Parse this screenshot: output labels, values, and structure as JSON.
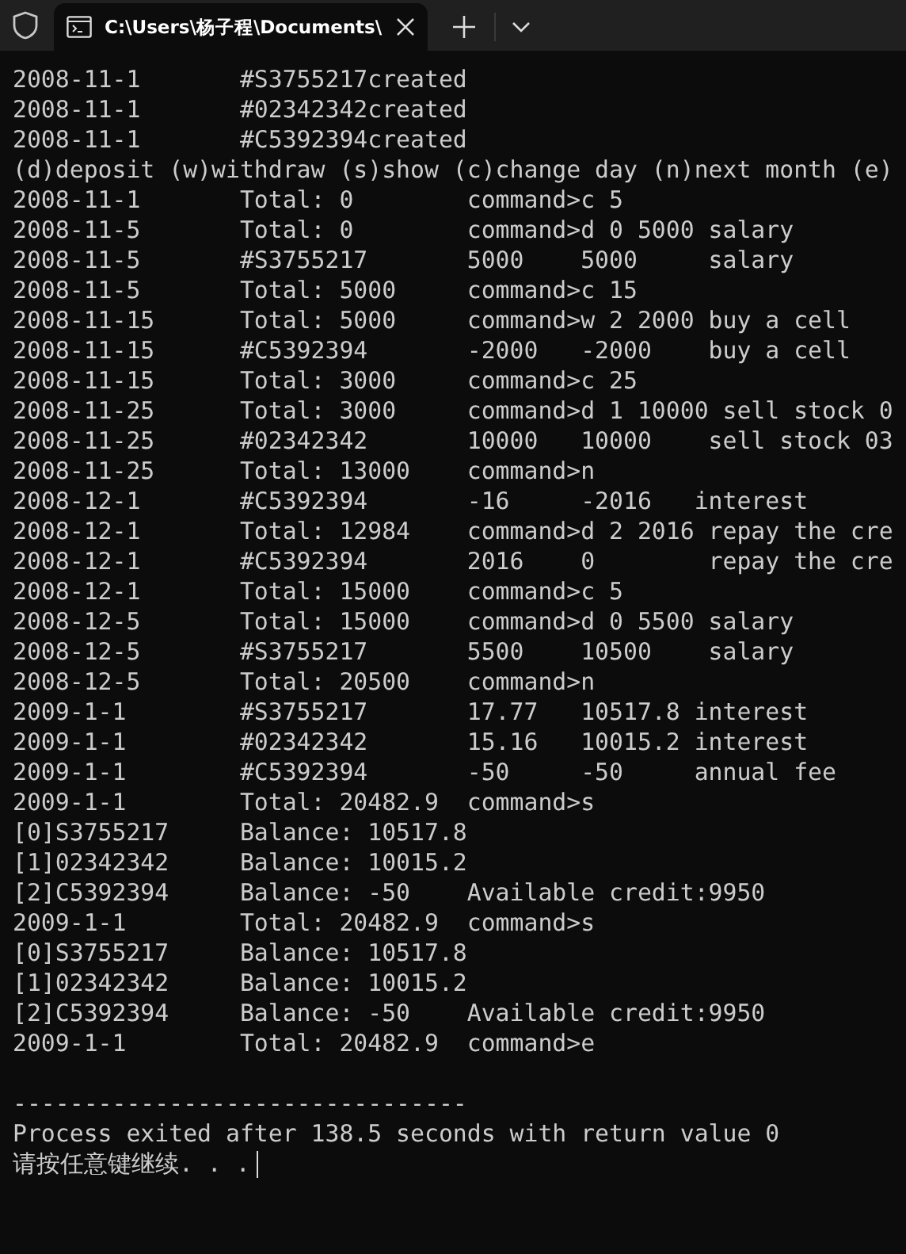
{
  "tab": {
    "title": "C:\\Users\\杨子程\\Documents\\"
  },
  "lines": [
    "2008-11-1       #S3755217created",
    "2008-11-1       #02342342created",
    "2008-11-1       #C5392394created",
    "(d)deposit (w)withdraw (s)show (c)change day (n)next month (e)",
    "2008-11-1       Total: 0        command>c 5",
    "2008-11-5       Total: 0        command>d 0 5000 salary",
    "2008-11-5       #S3755217       5000    5000     salary",
    "2008-11-5       Total: 5000     command>c 15",
    "2008-11-15      Total: 5000     command>w 2 2000 buy a cell",
    "2008-11-15      #C5392394       -2000   -2000    buy a cell",
    "2008-11-15      Total: 3000     command>c 25",
    "2008-11-25      Total: 3000     command>d 1 10000 sell stock 0",
    "2008-11-25      #02342342       10000   10000    sell stock 03",
    "2008-11-25      Total: 13000    command>n",
    "2008-12-1       #C5392394       -16     -2016   interest",
    "2008-12-1       Total: 12984    command>d 2 2016 repay the cre",
    "2008-12-1       #C5392394       2016    0        repay the cre",
    "2008-12-1       Total: 15000    command>c 5",
    "2008-12-5       Total: 15000    command>d 0 5500 salary",
    "2008-12-5       #S3755217       5500    10500    salary",
    "2008-12-5       Total: 20500    command>n",
    "2009-1-1        #S3755217       17.77   10517.8 interest",
    "2009-1-1        #02342342       15.16   10015.2 interest",
    "2009-1-1        #C5392394       -50     -50     annual fee",
    "2009-1-1        Total: 20482.9  command>s",
    "[0]S3755217     Balance: 10517.8",
    "[1]02342342     Balance: 10015.2",
    "[2]C5392394     Balance: -50    Available credit:9950",
    "2009-1-1        Total: 20482.9  command>s",
    "[0]S3755217     Balance: 10517.8",
    "[1]02342342     Balance: 10015.2",
    "[2]C5392394     Balance: -50    Available credit:9950",
    "2009-1-1        Total: 20482.9  command>e"
  ],
  "footer": {
    "rule": "--------------------------------",
    "message": "Process exited after 138.5 seconds with return value 0",
    "prompt": "请按任意键继续. . ."
  }
}
